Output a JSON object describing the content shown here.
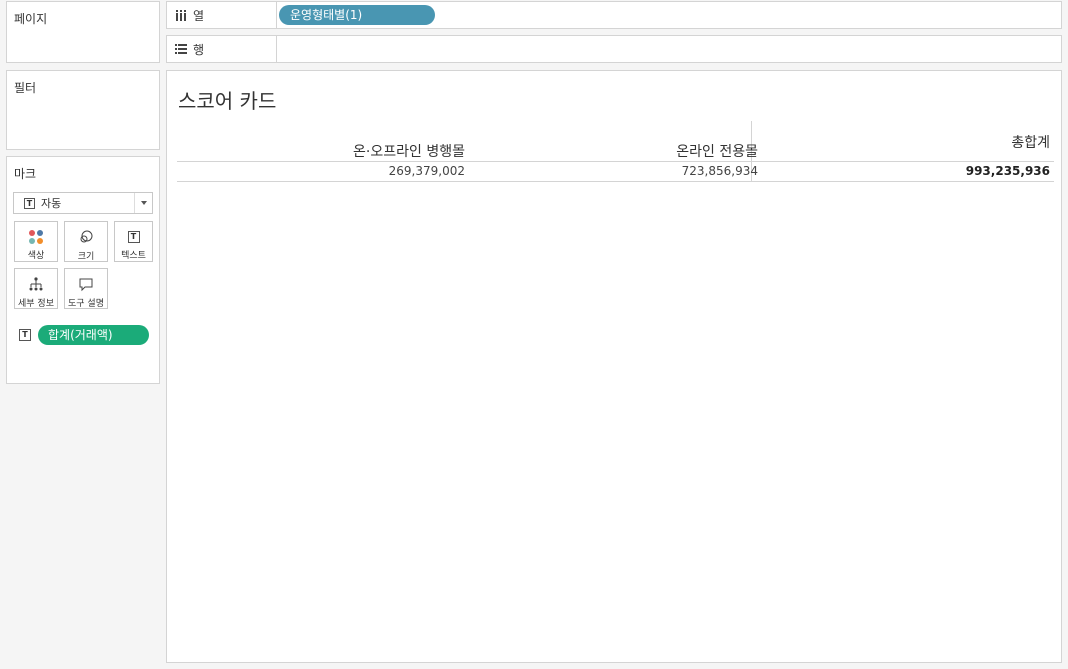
{
  "panels": {
    "pages": "페이지",
    "filters": "필터",
    "marks": "마크"
  },
  "marks": {
    "type": "자동",
    "buttons": {
      "color": "색상",
      "size": "크기",
      "text": "텍스트",
      "detail": "세부 정보",
      "tooltip": "도구 설명"
    },
    "pill": "합계(거래액)",
    "pill_color": "#1bab79"
  },
  "shelves": {
    "columns_label": "열",
    "rows_label": "행",
    "columns_pill": "운영형태별(1)",
    "columns_pill_color": "#4996b2"
  },
  "sheet": {
    "title": "스코어 카드",
    "headers": [
      "온·오프라인 병행몰",
      "온라인 전용몰",
      "총합계"
    ],
    "values": [
      "269,379,002",
      "723,856,934",
      "993,235,936"
    ]
  }
}
